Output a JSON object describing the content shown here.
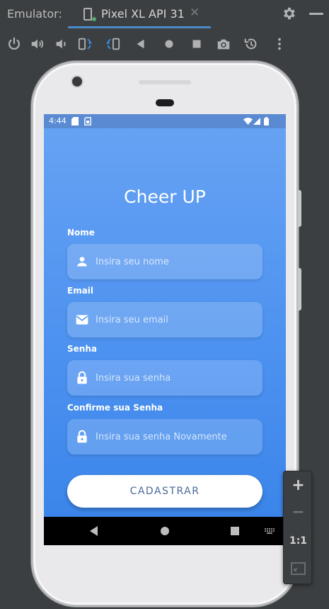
{
  "emulator": {
    "title": "Emulator:",
    "tab_label": "Pixel XL API 31",
    "tab_close": "✕",
    "accent_color": "#4a88c7",
    "running_indicator_color": "#59a869",
    "toolbar_icons": [
      "power-icon",
      "volume-up-icon",
      "volume-down-icon",
      "rotate-left-icon",
      "rotate-right-icon",
      "back-icon",
      "home-icon",
      "overview-icon",
      "screenshot-icon",
      "snapshot-icon",
      "more-options-icon"
    ]
  },
  "status_bar": {
    "time": "4:44",
    "icons": [
      "sd-card-icon",
      "sim-icon",
      "wifi-icon",
      "signal-icon",
      "battery-icon"
    ]
  },
  "app": {
    "title": "Cheer UP",
    "gradient_colors": [
      "#66a2f3",
      "#3b85ea"
    ],
    "fields": [
      {
        "label": "Nome",
        "placeholder": "Insira seu nome",
        "icon": "person-icon"
      },
      {
        "label": "Email",
        "placeholder": "Insira seu email",
        "icon": "mail-icon"
      },
      {
        "label": "Senha",
        "placeholder": "Insira sua senha",
        "icon": "lock-icon"
      },
      {
        "label": "Confirme sua Senha",
        "placeholder": "Insira sua senha Novamente",
        "icon": "lock-icon"
      }
    ],
    "submit_label": "CADASTRAR"
  },
  "nav_bar": {
    "buttons": [
      "back-icon",
      "home-icon",
      "overview-icon",
      "keyboard-icon"
    ]
  },
  "zoom_panel": {
    "zoom_in": "+",
    "zoom_out": "−",
    "actual_size": "1:1",
    "fit_icon": "fit-screen-icon"
  }
}
